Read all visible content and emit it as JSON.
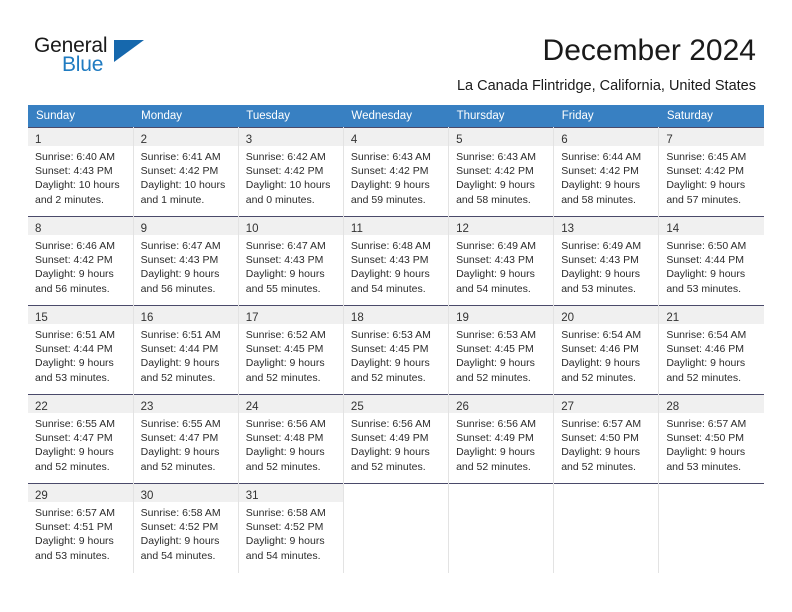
{
  "logo": {
    "word_top": "General",
    "word_bottom": "Blue",
    "triangle_icon": "blue-triangle-icon",
    "accent_color": "#1f7bc1",
    "triangle_color": "#1668ad"
  },
  "header": {
    "title": "December 2024",
    "subtitle": "La Canada Flintridge, California, United States"
  },
  "theme": {
    "header_row_bg": "#3880c2",
    "header_row_text": "#ffffff",
    "daynum_band_bg": "#f0f0f0",
    "cell_border": "#e3e3e3",
    "row_separator": "#4a4a6a"
  },
  "calendar": {
    "weekday_headers": [
      "Sunday",
      "Monday",
      "Tuesday",
      "Wednesday",
      "Thursday",
      "Friday",
      "Saturday"
    ],
    "weeks": [
      [
        {
          "day": "1",
          "sunrise": "Sunrise: 6:40 AM",
          "sunset": "Sunset: 4:43 PM",
          "daylight_1": "Daylight: 10 hours",
          "daylight_2": "and 2 minutes."
        },
        {
          "day": "2",
          "sunrise": "Sunrise: 6:41 AM",
          "sunset": "Sunset: 4:42 PM",
          "daylight_1": "Daylight: 10 hours",
          "daylight_2": "and 1 minute."
        },
        {
          "day": "3",
          "sunrise": "Sunrise: 6:42 AM",
          "sunset": "Sunset: 4:42 PM",
          "daylight_1": "Daylight: 10 hours",
          "daylight_2": "and 0 minutes."
        },
        {
          "day": "4",
          "sunrise": "Sunrise: 6:43 AM",
          "sunset": "Sunset: 4:42 PM",
          "daylight_1": "Daylight: 9 hours",
          "daylight_2": "and 59 minutes."
        },
        {
          "day": "5",
          "sunrise": "Sunrise: 6:43 AM",
          "sunset": "Sunset: 4:42 PM",
          "daylight_1": "Daylight: 9 hours",
          "daylight_2": "and 58 minutes."
        },
        {
          "day": "6",
          "sunrise": "Sunrise: 6:44 AM",
          "sunset": "Sunset: 4:42 PM",
          "daylight_1": "Daylight: 9 hours",
          "daylight_2": "and 58 minutes."
        },
        {
          "day": "7",
          "sunrise": "Sunrise: 6:45 AM",
          "sunset": "Sunset: 4:42 PM",
          "daylight_1": "Daylight: 9 hours",
          "daylight_2": "and 57 minutes."
        }
      ],
      [
        {
          "day": "8",
          "sunrise": "Sunrise: 6:46 AM",
          "sunset": "Sunset: 4:42 PM",
          "daylight_1": "Daylight: 9 hours",
          "daylight_2": "and 56 minutes."
        },
        {
          "day": "9",
          "sunrise": "Sunrise: 6:47 AM",
          "sunset": "Sunset: 4:43 PM",
          "daylight_1": "Daylight: 9 hours",
          "daylight_2": "and 56 minutes."
        },
        {
          "day": "10",
          "sunrise": "Sunrise: 6:47 AM",
          "sunset": "Sunset: 4:43 PM",
          "daylight_1": "Daylight: 9 hours",
          "daylight_2": "and 55 minutes."
        },
        {
          "day": "11",
          "sunrise": "Sunrise: 6:48 AM",
          "sunset": "Sunset: 4:43 PM",
          "daylight_1": "Daylight: 9 hours",
          "daylight_2": "and 54 minutes."
        },
        {
          "day": "12",
          "sunrise": "Sunrise: 6:49 AM",
          "sunset": "Sunset: 4:43 PM",
          "daylight_1": "Daylight: 9 hours",
          "daylight_2": "and 54 minutes."
        },
        {
          "day": "13",
          "sunrise": "Sunrise: 6:49 AM",
          "sunset": "Sunset: 4:43 PM",
          "daylight_1": "Daylight: 9 hours",
          "daylight_2": "and 53 minutes."
        },
        {
          "day": "14",
          "sunrise": "Sunrise: 6:50 AM",
          "sunset": "Sunset: 4:44 PM",
          "daylight_1": "Daylight: 9 hours",
          "daylight_2": "and 53 minutes."
        }
      ],
      [
        {
          "day": "15",
          "sunrise": "Sunrise: 6:51 AM",
          "sunset": "Sunset: 4:44 PM",
          "daylight_1": "Daylight: 9 hours",
          "daylight_2": "and 53 minutes."
        },
        {
          "day": "16",
          "sunrise": "Sunrise: 6:51 AM",
          "sunset": "Sunset: 4:44 PM",
          "daylight_1": "Daylight: 9 hours",
          "daylight_2": "and 52 minutes."
        },
        {
          "day": "17",
          "sunrise": "Sunrise: 6:52 AM",
          "sunset": "Sunset: 4:45 PM",
          "daylight_1": "Daylight: 9 hours",
          "daylight_2": "and 52 minutes."
        },
        {
          "day": "18",
          "sunrise": "Sunrise: 6:53 AM",
          "sunset": "Sunset: 4:45 PM",
          "daylight_1": "Daylight: 9 hours",
          "daylight_2": "and 52 minutes."
        },
        {
          "day": "19",
          "sunrise": "Sunrise: 6:53 AM",
          "sunset": "Sunset: 4:45 PM",
          "daylight_1": "Daylight: 9 hours",
          "daylight_2": "and 52 minutes."
        },
        {
          "day": "20",
          "sunrise": "Sunrise: 6:54 AM",
          "sunset": "Sunset: 4:46 PM",
          "daylight_1": "Daylight: 9 hours",
          "daylight_2": "and 52 minutes."
        },
        {
          "day": "21",
          "sunrise": "Sunrise: 6:54 AM",
          "sunset": "Sunset: 4:46 PM",
          "daylight_1": "Daylight: 9 hours",
          "daylight_2": "and 52 minutes."
        }
      ],
      [
        {
          "day": "22",
          "sunrise": "Sunrise: 6:55 AM",
          "sunset": "Sunset: 4:47 PM",
          "daylight_1": "Daylight: 9 hours",
          "daylight_2": "and 52 minutes."
        },
        {
          "day": "23",
          "sunrise": "Sunrise: 6:55 AM",
          "sunset": "Sunset: 4:47 PM",
          "daylight_1": "Daylight: 9 hours",
          "daylight_2": "and 52 minutes."
        },
        {
          "day": "24",
          "sunrise": "Sunrise: 6:56 AM",
          "sunset": "Sunset: 4:48 PM",
          "daylight_1": "Daylight: 9 hours",
          "daylight_2": "and 52 minutes."
        },
        {
          "day": "25",
          "sunrise": "Sunrise: 6:56 AM",
          "sunset": "Sunset: 4:49 PM",
          "daylight_1": "Daylight: 9 hours",
          "daylight_2": "and 52 minutes."
        },
        {
          "day": "26",
          "sunrise": "Sunrise: 6:56 AM",
          "sunset": "Sunset: 4:49 PM",
          "daylight_1": "Daylight: 9 hours",
          "daylight_2": "and 52 minutes."
        },
        {
          "day": "27",
          "sunrise": "Sunrise: 6:57 AM",
          "sunset": "Sunset: 4:50 PM",
          "daylight_1": "Daylight: 9 hours",
          "daylight_2": "and 52 minutes."
        },
        {
          "day": "28",
          "sunrise": "Sunrise: 6:57 AM",
          "sunset": "Sunset: 4:50 PM",
          "daylight_1": "Daylight: 9 hours",
          "daylight_2": "and 53 minutes."
        }
      ],
      [
        {
          "day": "29",
          "sunrise": "Sunrise: 6:57 AM",
          "sunset": "Sunset: 4:51 PM",
          "daylight_1": "Daylight: 9 hours",
          "daylight_2": "and 53 minutes."
        },
        {
          "day": "30",
          "sunrise": "Sunrise: 6:58 AM",
          "sunset": "Sunset: 4:52 PM",
          "daylight_1": "Daylight: 9 hours",
          "daylight_2": "and 54 minutes."
        },
        {
          "day": "31",
          "sunrise": "Sunrise: 6:58 AM",
          "sunset": "Sunset: 4:52 PM",
          "daylight_1": "Daylight: 9 hours",
          "daylight_2": "and 54 minutes."
        },
        {
          "day": "",
          "sunrise": "",
          "sunset": "",
          "daylight_1": "",
          "daylight_2": ""
        },
        {
          "day": "",
          "sunrise": "",
          "sunset": "",
          "daylight_1": "",
          "daylight_2": ""
        },
        {
          "day": "",
          "sunrise": "",
          "sunset": "",
          "daylight_1": "",
          "daylight_2": ""
        },
        {
          "day": "",
          "sunrise": "",
          "sunset": "",
          "daylight_1": "",
          "daylight_2": ""
        }
      ]
    ]
  }
}
